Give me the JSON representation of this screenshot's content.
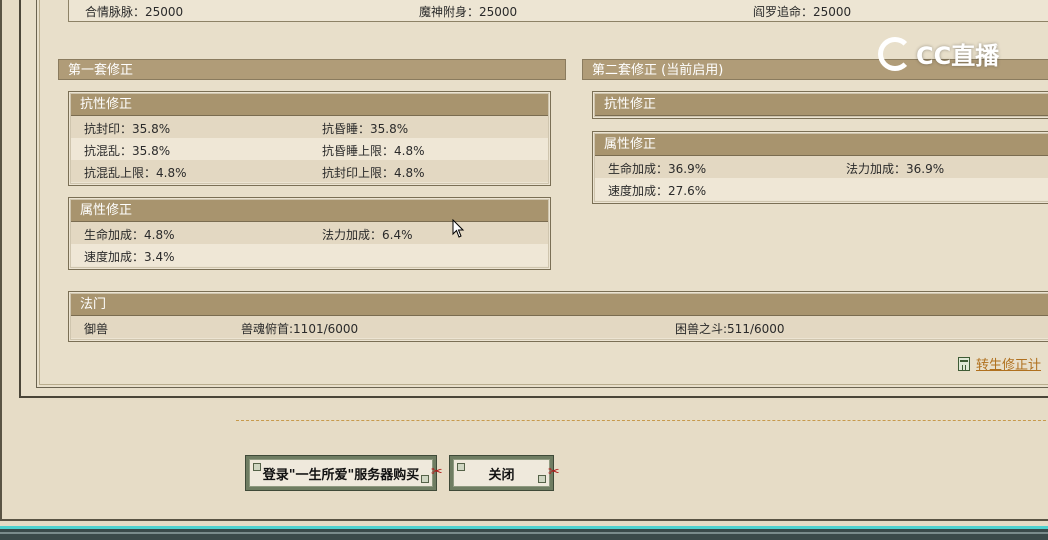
{
  "top_row": [
    {
      "label": "合情脉脉：25000"
    },
    {
      "label": "魔神附身：25000"
    },
    {
      "label": "阎罗追命：25000"
    }
  ],
  "set1": {
    "title": "第一套修正",
    "resist": {
      "title": "抗性修正",
      "rows": [
        [
          "抗封印：35.8%",
          "抗昏睡：35.8%"
        ],
        [
          "抗混乱：35.8%",
          "抗昏睡上限：4.8%"
        ],
        [
          "抗混乱上限：4.8%",
          "抗封印上限：4.8%"
        ]
      ]
    },
    "attr": {
      "title": "属性修正",
      "rows": [
        [
          "生命加成：4.8%",
          "法力加成：6.4%"
        ],
        [
          "速度加成：3.4%",
          ""
        ]
      ]
    }
  },
  "set2": {
    "title": "第二套修正 (当前启用)",
    "resist": {
      "title": "抗性修正"
    },
    "attr": {
      "title": "属性修正",
      "rows": [
        [
          "生命加成：36.9%",
          "法力加成：36.9%"
        ],
        [
          "速度加成：27.6%",
          ""
        ]
      ]
    }
  },
  "famen": {
    "title": "法门",
    "name": "御兽",
    "item1": "兽魂俯首:1101/6000",
    "item2": "困兽之斗:511/6000"
  },
  "link_label": "转生修正计",
  "buttons": {
    "buy": "登录\"一生所爱\"服务器购买",
    "close": "关闭"
  },
  "logo_text": "CC直播",
  "colors": {
    "panel_bg": "#e6dcc6",
    "header": "#b09c78",
    "row_alt": "#e3d8c2",
    "link": "#b0701e",
    "button_frame": "#6f7d62",
    "teal_bar": "#4fd2cf"
  }
}
